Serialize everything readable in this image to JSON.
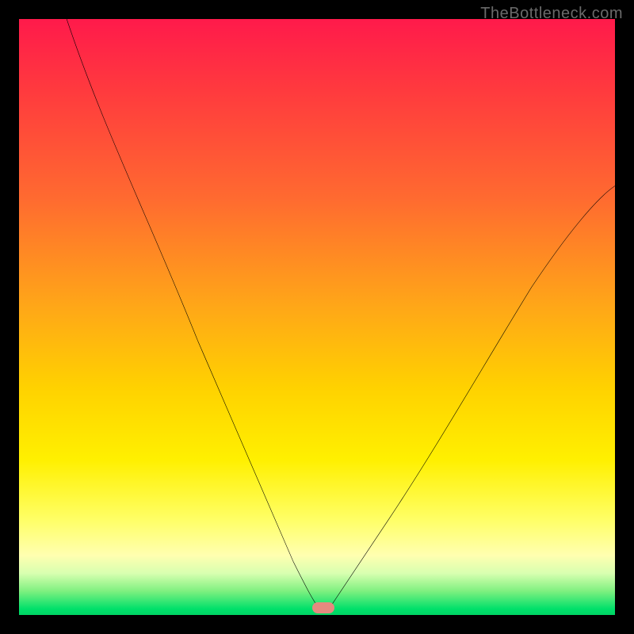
{
  "watermark": "TheBottleneck.com",
  "colors": {
    "frame": "#000000",
    "curve": "#000000",
    "marker": "#e58a7f",
    "gradient_stops": [
      "#ff1a4b",
      "#ff3a3e",
      "#ff6a30",
      "#ffa618",
      "#ffd200",
      "#fff000",
      "#ffff66",
      "#ffffb0",
      "#d8ffb0",
      "#7ef080",
      "#00e06a",
      "#00d564"
    ]
  },
  "chart_data": {
    "type": "line",
    "title": "",
    "xlabel": "",
    "ylabel": "",
    "xlim": [
      0,
      100
    ],
    "ylim": [
      0,
      100
    ],
    "legend": null,
    "series": [
      {
        "name": "bottleneck-curve-left",
        "x": [
          8,
          12,
          18,
          24,
          30,
          36,
          42,
          46,
          49,
          50.5
        ],
        "y": [
          100,
          88,
          74,
          60,
          46,
          32,
          18,
          9,
          3,
          1
        ]
      },
      {
        "name": "bottleneck-curve-right",
        "x": [
          52,
          56,
          62,
          70,
          78,
          86,
          94,
          100
        ],
        "y": [
          1,
          5,
          12,
          24,
          38,
          52,
          64,
          72
        ]
      }
    ],
    "marker": {
      "x": 51,
      "y": 0.8,
      "shape": "pill"
    },
    "note": "x and y are percent of plot area; y=100 is top edge, y=0 is bottom green band."
  }
}
